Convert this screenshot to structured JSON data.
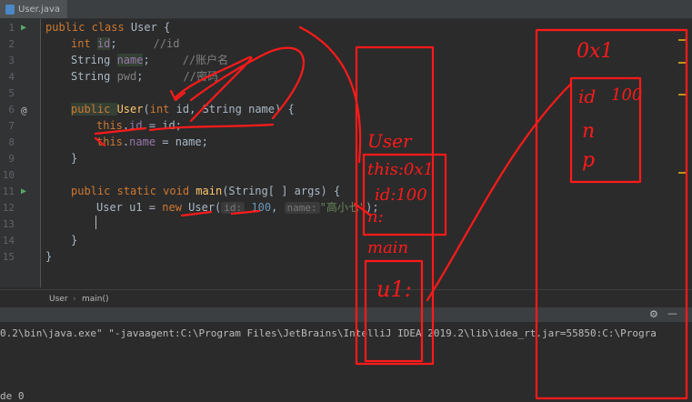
{
  "tab": {
    "label": "User.java"
  },
  "gutter": {
    "line_numbers": [
      "1",
      "2",
      "3",
      "4",
      "5",
      "6",
      "7",
      "8",
      "9",
      "10",
      "11",
      "12",
      "13",
      "14",
      "15"
    ]
  },
  "code": {
    "l1": {
      "kw": "public class ",
      "name": "User",
      "rest": " {"
    },
    "l2": {
      "kw": "int ",
      "field": "id",
      "semi": ";",
      "comment": "//id"
    },
    "l3": {
      "type": "String ",
      "field": "name",
      "semi": ";",
      "comment": "//账户名"
    },
    "l4": {
      "type": "String ",
      "field": "pwd",
      "semi": ";",
      "comment": "//密码"
    },
    "l6": {
      "kw": "public ",
      "name": "User",
      "p1": "(",
      "kw2": "int",
      "p2": " id, String name) {"
    },
    "l7": {
      "kw": "this",
      "dot": ".",
      "field": "id",
      "rest": " = id;"
    },
    "l8": {
      "kw": "this",
      "dot": ".",
      "field": "name",
      "rest": " = name;"
    },
    "l9": {
      "text": "}"
    },
    "l11": {
      "kw": "public static void ",
      "name": "main",
      "rest": "(String[ ] args) {"
    },
    "l12": {
      "pre": "User u1 = ",
      "kw": "new ",
      "name": "User(",
      "hint1": "id:",
      "num": "100",
      "comma": ", ",
      "hint2": "name:",
      "str": "\"高小七\"",
      "end": ");"
    },
    "l14": {
      "text": "}"
    },
    "l15": {
      "text": "}"
    }
  },
  "breadcrumb": {
    "class": "User",
    "sep": "›",
    "method": "main()"
  },
  "runbar": {
    "gear": "⚙",
    "minimize": "—"
  },
  "console": {
    "line1": "0.2\\bin\\java.exe\" \"-javaagent:C:\\Program Files\\JetBrains\\IntelliJ IDEA 2019.2\\lib\\idea_rt.jar=55850:C:\\Progra",
    "line2": "de 0"
  },
  "annotations": {
    "heap_addr": "0x1",
    "heap_id": "id",
    "heap_id_value": "100",
    "heap_n": "n",
    "heap_p": "p",
    "user_label": "User",
    "this_label": "this:0x1",
    "id_label": "id:100",
    "n_label": "n:",
    "main_label": "main",
    "u1_label": "u1:"
  },
  "colors": {
    "ink": "#ff1a1a",
    "background": "#2b2b2b"
  }
}
